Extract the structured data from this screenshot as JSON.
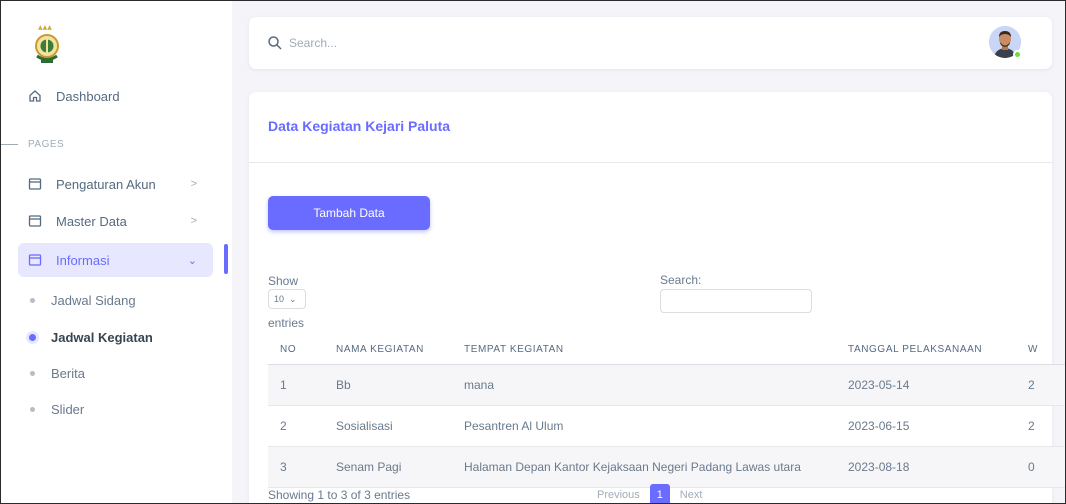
{
  "app": {
    "brand_color": "#696cff"
  },
  "sidebar": {
    "logo_icon": "kejaksaan-emblem-icon",
    "dashboard": {
      "label": "Dashboard",
      "icon": "home-icon"
    },
    "section_pages": "PAGES",
    "items": [
      {
        "label": "Pengaturan Akun",
        "icon": "window-icon",
        "chevron": ">"
      },
      {
        "label": "Master Data",
        "icon": "window-icon",
        "chevron": ">"
      },
      {
        "label": "Informasi",
        "icon": "window-icon",
        "chevron": "⌄",
        "active": true
      }
    ],
    "subitems": [
      {
        "label": "Jadwal Sidang"
      },
      {
        "label": "Jadwal Kegiatan",
        "active": true
      },
      {
        "label": "Berita"
      },
      {
        "label": "Slider"
      }
    ]
  },
  "topbar": {
    "search_placeholder": "Search...",
    "avatar_icon": "user-avatar",
    "status_color": "#71dd37"
  },
  "card": {
    "title": "Data Kegiatan Kejari Paluta",
    "add_button": "Tambah Data",
    "show_label": "Show",
    "entries_label": "entries",
    "page_length": "10",
    "search_label": "Search:",
    "table": {
      "columns": [
        "NO",
        "NAMA KEGIATAN",
        "TEMPAT KEGIATAN",
        "TANGGAL PELAKSANAAN",
        "W"
      ],
      "rows": [
        [
          "1",
          "Bb",
          "mana",
          "2023-05-14",
          "2"
        ],
        [
          "2",
          "Sosialisasi",
          "Pesantren Al Ulum",
          "2023-06-15",
          "2"
        ],
        [
          "3",
          "Senam Pagi",
          "Halaman Depan Kantor Kejaksaan Negeri Padang Lawas utara",
          "2023-08-18",
          "0"
        ]
      ]
    },
    "info": "Showing 1 to 3 of 3 entries",
    "pagination": {
      "previous": "Previous",
      "current": "1",
      "next": "Next"
    }
  }
}
